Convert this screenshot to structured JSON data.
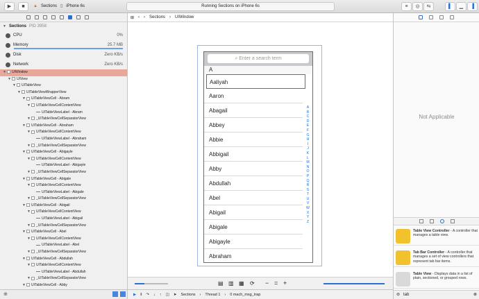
{
  "toolbar": {
    "scheme_name": "Sections",
    "device_name": "iPhone 6s",
    "activity_text": "Running Sections on iPhone 6s"
  },
  "debug_navigator": {
    "process_name": "Sections",
    "process_pid": "PID 3958",
    "gauges": [
      {
        "label": "CPU",
        "value": "0%"
      },
      {
        "label": "Memory",
        "value": "25.7 MB"
      },
      {
        "label": "Disk",
        "value": "Zero KB/s"
      },
      {
        "label": "Network",
        "value": "Zero KB/s"
      }
    ],
    "tree": [
      {
        "label": "UIWindow",
        "depth": 0,
        "sel": true,
        "kind": "box"
      },
      {
        "label": "UIView",
        "depth": 1,
        "kind": "box"
      },
      {
        "label": "UITableView",
        "depth": 2,
        "kind": "box"
      },
      {
        "label": "UITableViewWrapperView",
        "depth": 3,
        "kind": "box"
      },
      {
        "label": "UITableViewCell - Abram",
        "depth": 4,
        "kind": "box"
      },
      {
        "label": "UITableViewCellContentView",
        "depth": 5,
        "kind": "box"
      },
      {
        "label": "UITableViewLabel - Abram",
        "depth": 6,
        "kind": "line"
      },
      {
        "label": "_UITableViewCellSeparatorView",
        "depth": 5,
        "kind": "box"
      },
      {
        "label": "UITableViewCell - Abraham",
        "depth": 4,
        "kind": "box"
      },
      {
        "label": "UITableViewCellContentView",
        "depth": 5,
        "kind": "box"
      },
      {
        "label": "UITableViewLabel - Abraham",
        "depth": 6,
        "kind": "line"
      },
      {
        "label": "_UITableViewCellSeparatorView",
        "depth": 5,
        "kind": "box"
      },
      {
        "label": "UITableViewCell - Abigayle",
        "depth": 4,
        "kind": "box"
      },
      {
        "label": "UITableViewCellContentView",
        "depth": 5,
        "kind": "box"
      },
      {
        "label": "UITableViewLabel - Abigayle",
        "depth": 6,
        "kind": "line"
      },
      {
        "label": "_UITableViewCellSeparatorView",
        "depth": 5,
        "kind": "box"
      },
      {
        "label": "UITableViewCell - Abigale",
        "depth": 4,
        "kind": "box"
      },
      {
        "label": "UITableViewCellContentView",
        "depth": 5,
        "kind": "box"
      },
      {
        "label": "UITableViewLabel - Abigale",
        "depth": 6,
        "kind": "line"
      },
      {
        "label": "_UITableViewCellSeparatorView",
        "depth": 5,
        "kind": "box"
      },
      {
        "label": "UITableViewCell - Abigail",
        "depth": 4,
        "kind": "box"
      },
      {
        "label": "UITableViewCellContentView",
        "depth": 5,
        "kind": "box"
      },
      {
        "label": "UITableViewLabel - Abigail",
        "depth": 6,
        "kind": "line"
      },
      {
        "label": "_UITableViewCellSeparatorView",
        "depth": 5,
        "kind": "box"
      },
      {
        "label": "UITableViewCell - Abel",
        "depth": 4,
        "kind": "box"
      },
      {
        "label": "UITableViewCellContentView",
        "depth": 5,
        "kind": "box"
      },
      {
        "label": "UITableViewLabel - Abel",
        "depth": 6,
        "kind": "line"
      },
      {
        "label": "_UITableViewCellSeparatorView",
        "depth": 5,
        "kind": "box"
      },
      {
        "label": "UITableViewCell - Abdullah",
        "depth": 4,
        "kind": "box"
      },
      {
        "label": "UITableViewCellContentView",
        "depth": 5,
        "kind": "box"
      },
      {
        "label": "UITableViewLabel - Abdullah",
        "depth": 6,
        "kind": "line"
      },
      {
        "label": "_UITableViewCellSeparatorView",
        "depth": 5,
        "kind": "box"
      },
      {
        "label": "UITableViewCell - Abby",
        "depth": 4,
        "kind": "box"
      }
    ]
  },
  "jump_bar": {
    "item1": "Sections",
    "item2": "UIWindow"
  },
  "simulator": {
    "search_placeholder": "Enter a search term",
    "section_header": "A",
    "rows": [
      "Aaliyah",
      "Aaron",
      "Abagail",
      "Abbey",
      "Abbie",
      "Abbigail",
      "Abby",
      "Abdullah",
      "Abel",
      "Abigail",
      "Abigale",
      "Abigayle",
      "Abraham"
    ],
    "index": [
      "A",
      "B",
      "C",
      "D",
      "E",
      "F",
      "G",
      "H",
      "I",
      "J",
      "K",
      "L",
      "M",
      "N",
      "O",
      "P",
      "Q",
      "R",
      "S",
      "T",
      "U",
      "V",
      "W",
      "X",
      "Y",
      "Z"
    ]
  },
  "status_bar": {
    "target": "Sections",
    "thread": "Thread 1",
    "frame": "0 mach_msg_trap"
  },
  "inspector": {
    "empty_text": "Not Applicable"
  },
  "library": {
    "items": [
      {
        "title": "Table View Controller",
        "desc": " - A controller that manages a table view.",
        "color": "#f2c12e"
      },
      {
        "title": "Tab Bar Controller",
        "desc": " - A controller that manages a set of view controllers that represent tab bar items.",
        "color": "#f2c12e"
      },
      {
        "title": "Table View",
        "desc": " - Displays data in a list of plain, sectioned, or grouped rows.",
        "color": "#d9d9d9"
      }
    ],
    "filter_value": "tab"
  }
}
